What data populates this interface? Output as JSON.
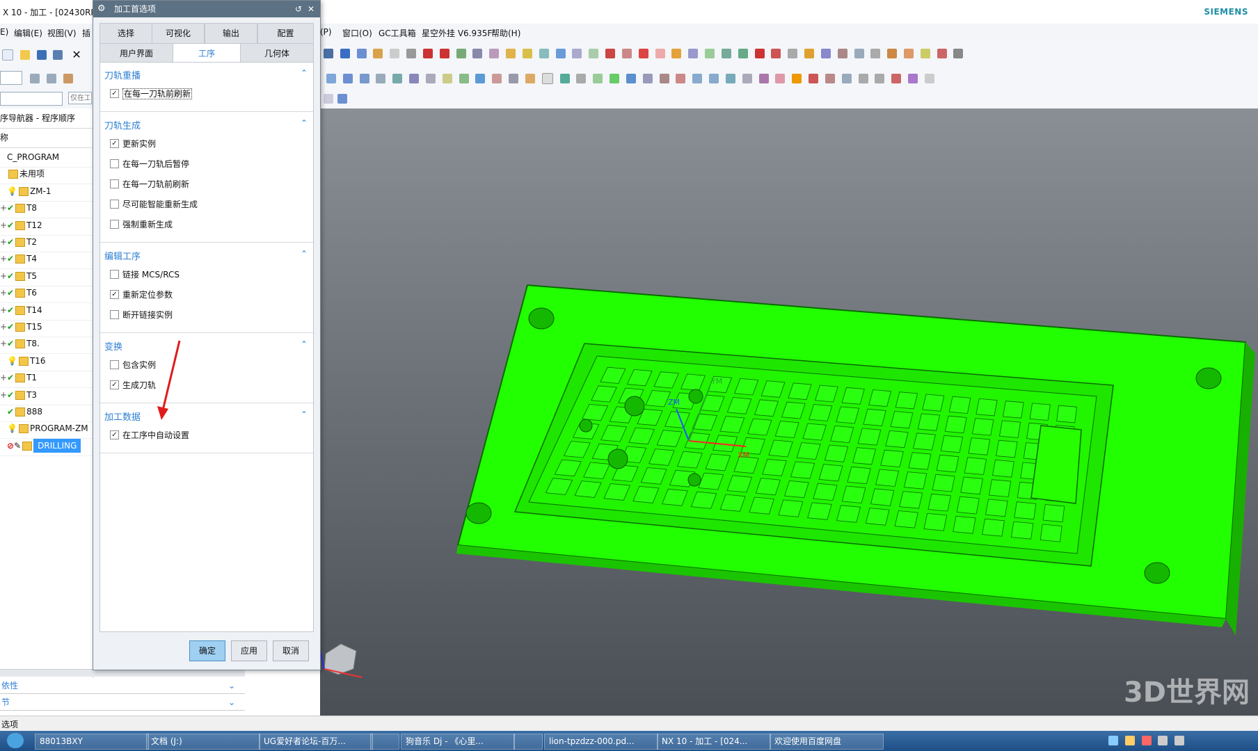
{
  "window": {
    "title": "X 10 - 加工 - [02430RPV",
    "brand": "SIEMENS"
  },
  "menubar": {
    "left_items": [
      "E)",
      "编辑(E)",
      "视图(V)",
      "插"
    ],
    "right_items": [
      "(P)",
      "窗口(O)",
      "GC工具箱",
      "星空外挂 V6.935F",
      "帮助(H)"
    ]
  },
  "filters": {
    "search_placeholder": "仅在工"
  },
  "navigator": {
    "title": "序导航器 - 程序顺序",
    "column_header": "称",
    "rows": [
      {
        "label": "C_PROGRAM",
        "status": "none"
      },
      {
        "label": "未用项",
        "status": "folder"
      },
      {
        "label": "ZM-1",
        "status": "bulb"
      },
      {
        "label": "T8",
        "status": "check"
      },
      {
        "label": "T12",
        "status": "check"
      },
      {
        "label": "T2",
        "status": "check"
      },
      {
        "label": "T4",
        "status": "check"
      },
      {
        "label": "T5",
        "status": "check"
      },
      {
        "label": "T6",
        "status": "check"
      },
      {
        "label": "T14",
        "status": "check"
      },
      {
        "label": "T15",
        "status": "check"
      },
      {
        "label": "T8.",
        "status": "check"
      },
      {
        "label": "T16",
        "status": "bulb"
      },
      {
        "label": "T1",
        "status": "check"
      },
      {
        "label": "T3",
        "status": "check"
      },
      {
        "label": "888",
        "status": "check"
      },
      {
        "label": "PROGRAM-ZM",
        "status": "bulb"
      },
      {
        "label": "DRILLING",
        "status": "forbidden"
      }
    ]
  },
  "lower_panels": {
    "dependency": "依性",
    "details": "节"
  },
  "status": {
    "text": "选项"
  },
  "dialog": {
    "title": "加工首选项",
    "tabs_row1": [
      "选择",
      "可视化",
      "输出",
      "配置"
    ],
    "tabs_row2": [
      "用户界面",
      "工序",
      "几何体"
    ],
    "active_tab": "工序",
    "sections": [
      {
        "title": "刀轨重播",
        "options": [
          {
            "label": "在每一刀轨前刷新",
            "checked": true
          }
        ]
      },
      {
        "title": "刀轨生成",
        "options": [
          {
            "label": "更新实例",
            "checked": true
          },
          {
            "label": "在每一刀轨后暂停",
            "checked": false
          },
          {
            "label": "在每一刀轨前刷新",
            "checked": false
          },
          {
            "label": "尽可能智能重新生成",
            "checked": false
          },
          {
            "label": "强制重新生成",
            "checked": false
          }
        ]
      },
      {
        "title": "编辑工序",
        "options": [
          {
            "label": "链接 MCS/RCS",
            "checked": false
          },
          {
            "label": "重新定位参数",
            "checked": true
          },
          {
            "label": "断开链接实例",
            "checked": false
          }
        ]
      },
      {
        "title": "变换",
        "options": [
          {
            "label": "包含实例",
            "checked": false
          },
          {
            "label": "生成刀轨",
            "checked": true
          }
        ]
      },
      {
        "title": "加工数据",
        "options": [
          {
            "label": "在工序中自动设置",
            "checked": true
          }
        ]
      }
    ],
    "buttons": {
      "ok": "确定",
      "apply": "应用",
      "cancel": "取消"
    }
  },
  "viewport": {
    "axis_labels": {
      "zm": "ZM",
      "xm": "XM",
      "ym": "YM"
    },
    "watermark": "3D世界网"
  },
  "taskbar": {
    "items": [
      "88013BXY",
      "文档 (J:)",
      "UG爱好者论坛-百万...",
      "",
      "狗音乐 Dj - 《心里...",
      "",
      "lion-tpzdzz-000.pd...",
      "NX 10 - 加工 - [024...",
      "欢迎使用百度网盘"
    ]
  }
}
